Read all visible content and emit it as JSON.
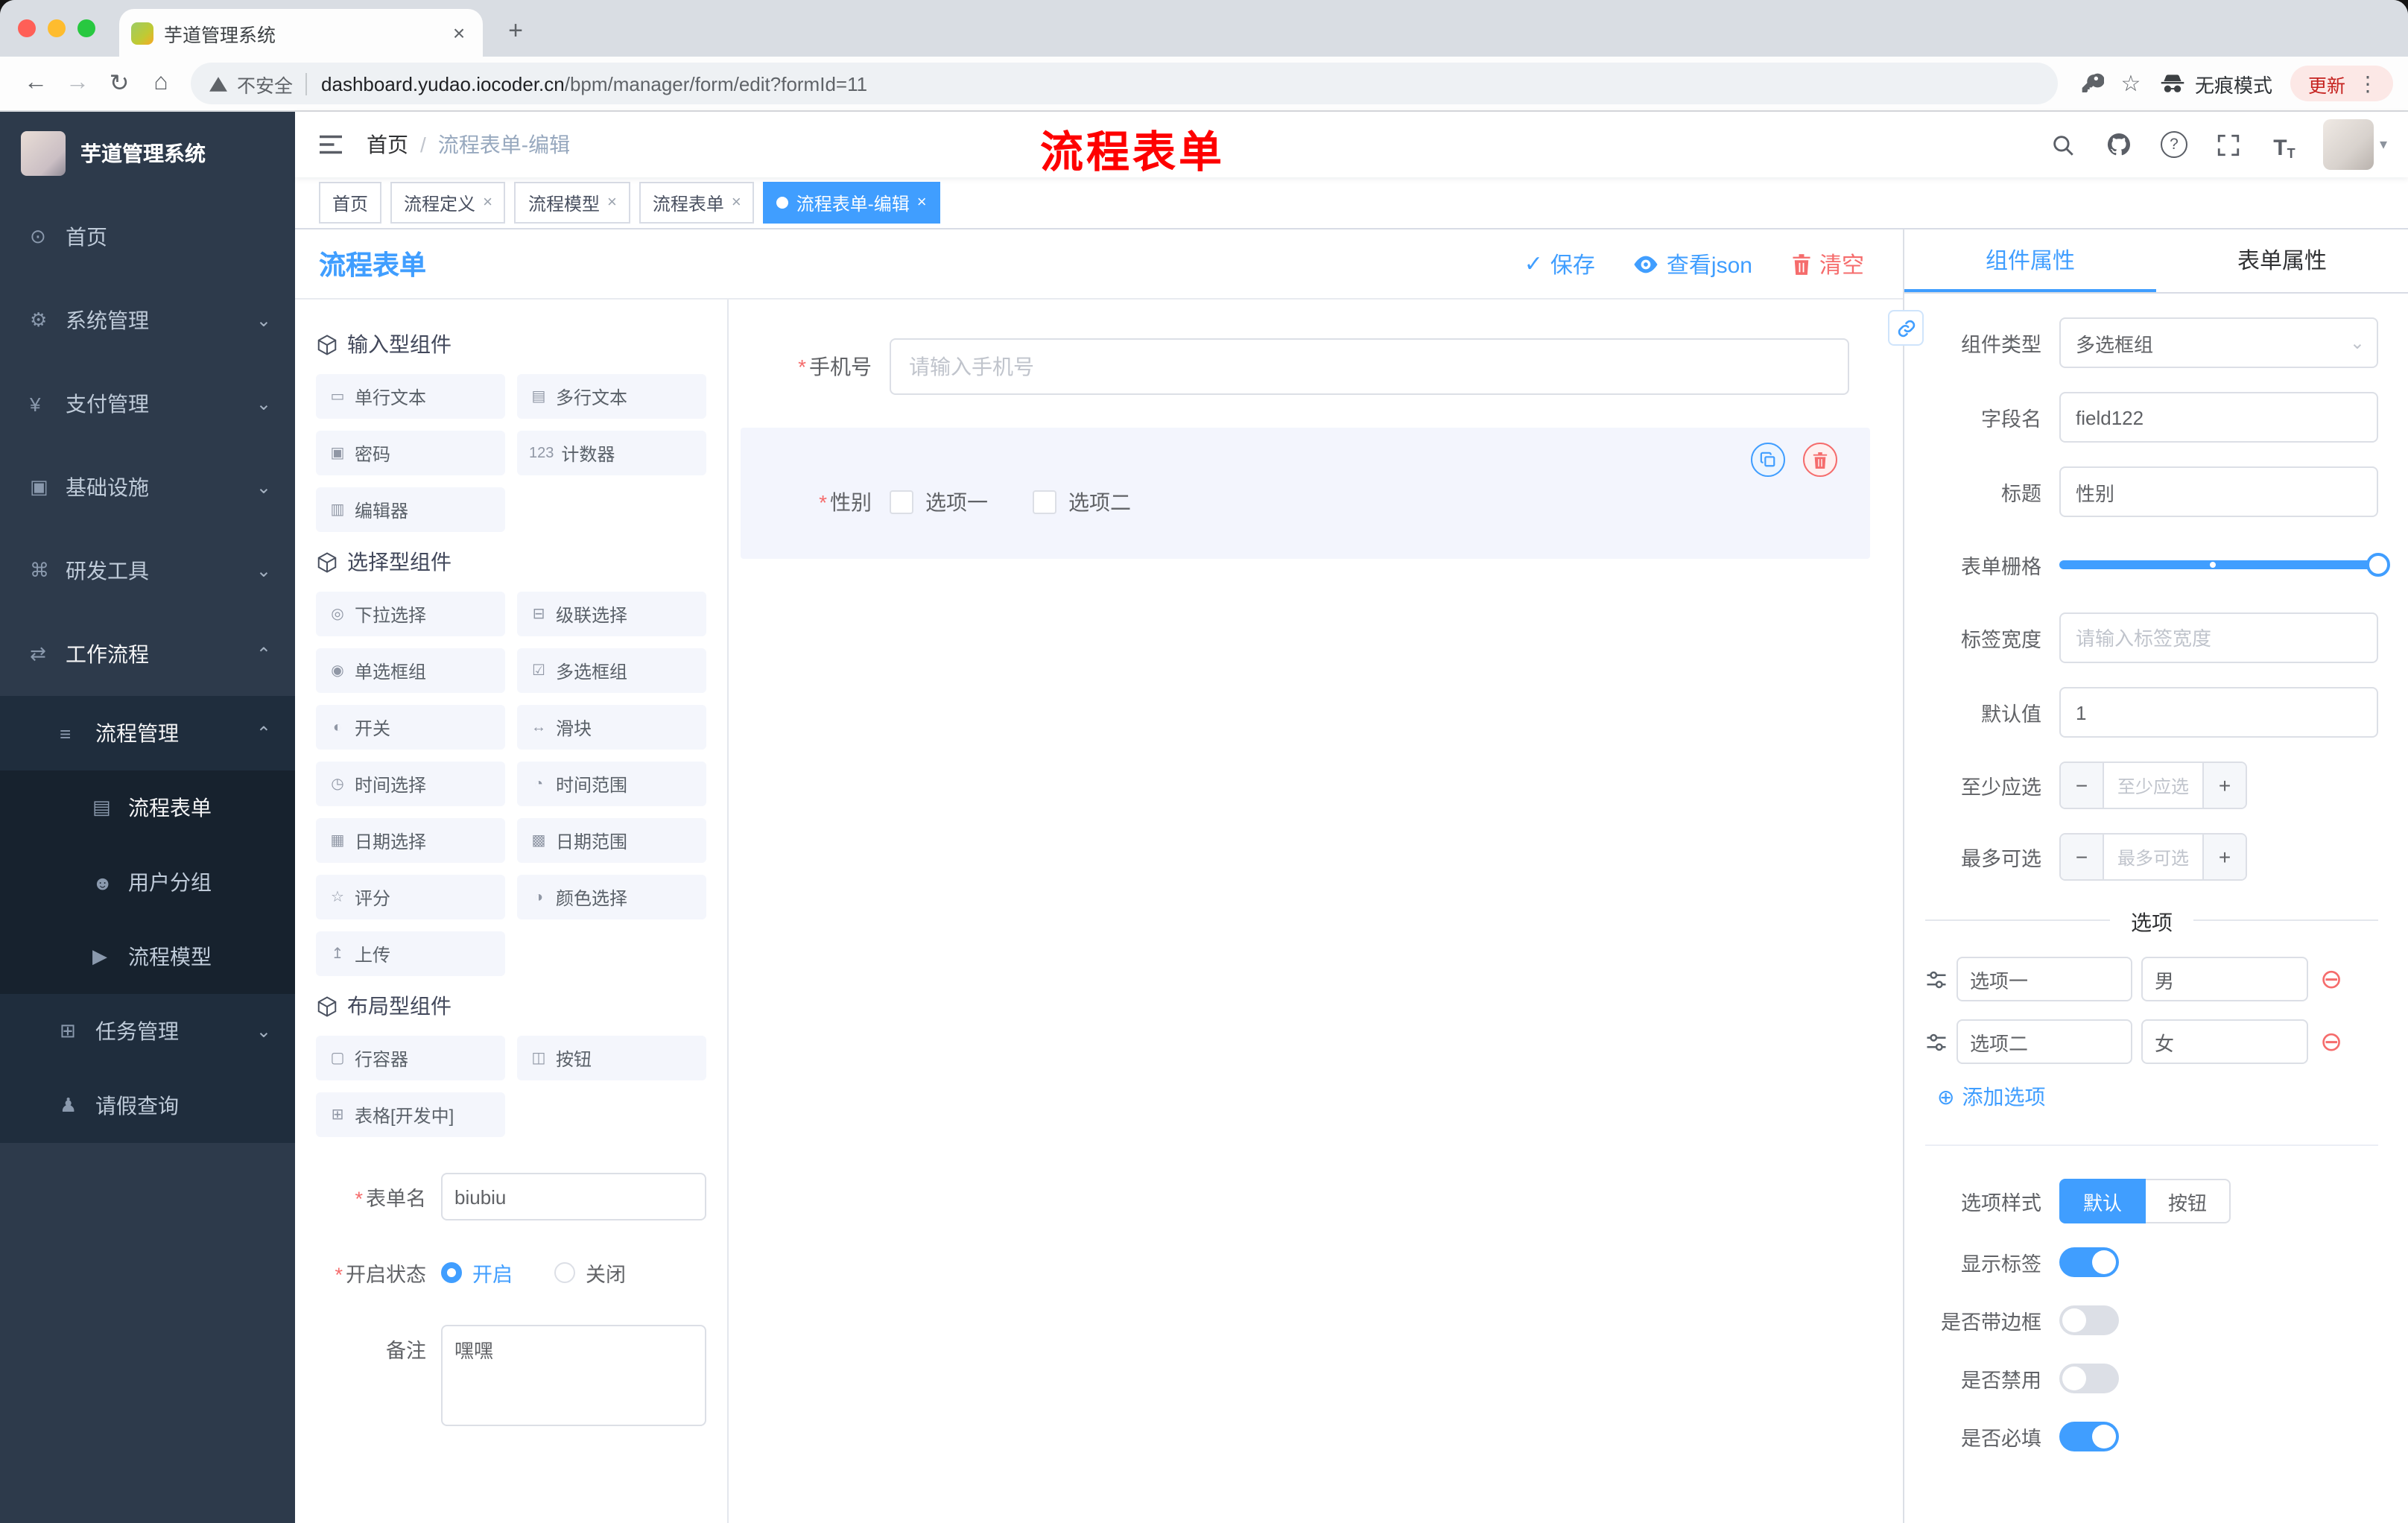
{
  "glyphs": {
    "close": "×",
    "plus": "+",
    "back": "←",
    "forward": "→",
    "reload": "↻",
    "home": "⌂",
    "star": "☆",
    "kebab": "⋮",
    "caret_down": "▾",
    "chev_down": "⌄",
    "minus": "−",
    "add": "⊕",
    "remove": "⊖",
    "question": "?",
    "font_big": "T",
    "font_small": "T",
    "check": "✓",
    "asterisk": "*"
  },
  "browser": {
    "tab_title": "芋道管理系统",
    "security_label": "不安全",
    "url_host": "dashboard.yudao.iocoder.cn",
    "url_path": "/bpm/manager/form/edit?formId=11",
    "incognito_label": "无痕模式",
    "update_label": "更新"
  },
  "sidebar": {
    "logo_title": "芋道管理系统",
    "items": [
      {
        "label": "首页",
        "icon": "⊙",
        "chevron": ""
      },
      {
        "label": "系统管理",
        "icon": "⚙",
        "chevron": "⌄"
      },
      {
        "label": "支付管理",
        "icon": "¥",
        "chevron": "⌄"
      },
      {
        "label": "基础设施",
        "icon": "▣",
        "chevron": "⌄"
      },
      {
        "label": "研发工具",
        "icon": "⌘",
        "chevron": "⌄"
      },
      {
        "label": "工作流程",
        "icon": "⇄",
        "chevron": "⌃"
      },
      {
        "label": "流程管理",
        "icon": "≡",
        "chevron": "⌃"
      },
      {
        "label": "流程表单",
        "icon": "▤",
        "chevron": ""
      },
      {
        "label": "用户分组",
        "icon": "☻",
        "chevron": ""
      },
      {
        "label": "流程模型",
        "icon": "▶",
        "chevron": ""
      },
      {
        "label": "任务管理",
        "icon": "⊞",
        "chevron": "⌄"
      },
      {
        "label": "请假查询",
        "icon": "♟",
        "chevron": ""
      }
    ]
  },
  "header": {
    "breadcrumb_home": "首页",
    "breadcrumb_sep": "/",
    "breadcrumb_current": "流程表单-编辑",
    "annotation": "流程表单"
  },
  "tags": [
    {
      "label": "首页"
    },
    {
      "label": "流程定义"
    },
    {
      "label": "流程模型"
    },
    {
      "label": "流程表单"
    },
    {
      "label": "流程表单-编辑"
    }
  ],
  "designer": {
    "title": "流程表单",
    "save_label": "保存",
    "view_json_label": "查看json",
    "clear_label": "清空",
    "groups": [
      {
        "title": "输入型组件",
        "items": [
          {
            "icon": "▭",
            "label": "单行文本"
          },
          {
            "icon": "▤",
            "label": "多行文本"
          },
          {
            "icon": "▣",
            "label": "密码"
          },
          {
            "icon": "123",
            "label": "计数器"
          },
          {
            "icon": "▥",
            "label": "编辑器"
          }
        ]
      },
      {
        "title": "选择型组件",
        "items": [
          {
            "icon": "◎",
            "label": "下拉选择"
          },
          {
            "icon": "⊟",
            "label": "级联选择"
          },
          {
            "icon": "◉",
            "label": "单选框组"
          },
          {
            "icon": "☑",
            "label": "多选框组"
          },
          {
            "icon": "◐",
            "label": "开关"
          },
          {
            "icon": "↔",
            "label": "滑块"
          },
          {
            "icon": "◷",
            "label": "时间选择"
          },
          {
            "icon": "◔",
            "label": "时间范围"
          },
          {
            "icon": "▦",
            "label": "日期选择"
          },
          {
            "icon": "▩",
            "label": "日期范围"
          },
          {
            "icon": "☆",
            "label": "评分"
          },
          {
            "icon": "◑",
            "label": "颜色选择"
          },
          {
            "icon": "↥",
            "label": "上传"
          }
        ]
      },
      {
        "title": "布局型组件",
        "items": [
          {
            "icon": "▢",
            "label": "行容器"
          },
          {
            "icon": "◫",
            "label": "按钮"
          },
          {
            "icon": "⊞",
            "label": "表格[开发中]"
          }
        ]
      }
    ],
    "meta": {
      "form_name_label": "表单名",
      "form_name_value": "biubiu",
      "status_label": "开启状态",
      "status_on": "开启",
      "status_off": "关闭",
      "remark_label": "备注",
      "remark_value": "嘿嘿"
    },
    "canvas": {
      "phone_label": "手机号",
      "phone_placeholder": "请输入手机号",
      "gender_label": "性别",
      "gender_options": [
        {
          "label": "选项一"
        },
        {
          "label": "选项二"
        }
      ]
    }
  },
  "props": {
    "tab_component": "组件属性",
    "tab_form": "表单属性",
    "component_type_label": "组件类型",
    "component_type_value": "多选框组",
    "field_name_label": "字段名",
    "field_name_value": "field122",
    "title_label": "标题",
    "title_value": "性别",
    "grid_label": "表单栅格",
    "label_width_label": "标签宽度",
    "label_width_placeholder": "请输入标签宽度",
    "default_label": "默认值",
    "default_value": "1",
    "min_label": "至少应选",
    "min_placeholder": "至少应选",
    "max_label": "最多可选",
    "max_placeholder": "最多可选",
    "options_title": "选项",
    "options": [
      {
        "label": "选项一",
        "value": "男"
      },
      {
        "label": "选项二",
        "value": "女"
      }
    ],
    "add_option_label": "添加选项",
    "style_label": "选项样式",
    "style_default": "默认",
    "style_button": "按钮",
    "switch_rows": [
      {
        "label": "显示标签",
        "on": true
      },
      {
        "label": "是否带边框",
        "on": false
      },
      {
        "label": "是否禁用",
        "on": false
      },
      {
        "label": "是否必填",
        "on": true
      }
    ]
  },
  "colors": {
    "primary": "#409eff",
    "danger": "#f56c6c",
    "sidebar_bg": "#2d3a4b",
    "annotation_red": "#fe0000"
  }
}
